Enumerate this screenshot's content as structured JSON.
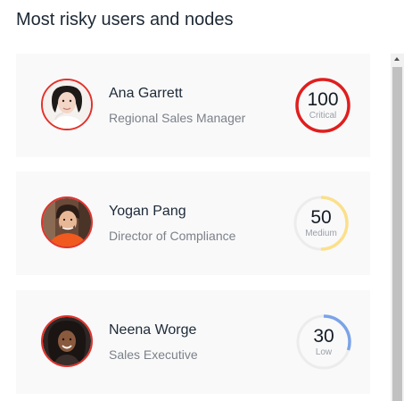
{
  "header": {
    "title": "Most risky users and nodes"
  },
  "users": [
    {
      "name": "Ana Garrett",
      "role": "Regional Sales Manager",
      "score": "100",
      "level": "Critical",
      "fraction": 1.0,
      "color": "#e01e1e"
    },
    {
      "name": "Yogan Pang",
      "role": "Director of Compliance",
      "score": "50",
      "level": "Medium",
      "fraction": 0.5,
      "color": "#fbe08a"
    },
    {
      "name": "Neena Worge",
      "role": "Sales Executive",
      "score": "30",
      "level": "Low",
      "fraction": 0.3,
      "color": "#7ba3e8"
    }
  ],
  "colors": {
    "avatar_ring": "#e4322b",
    "track": "#ececec"
  }
}
